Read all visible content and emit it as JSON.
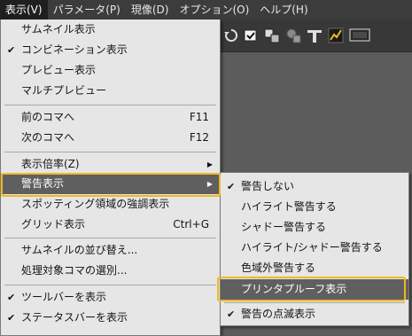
{
  "menubar": {
    "items": [
      {
        "label": "表示(V)"
      },
      {
        "label": "パラメータ(P)"
      },
      {
        "label": "現像(D)"
      },
      {
        "label": "オプション(O)"
      },
      {
        "label": "ヘルプ(H)"
      }
    ]
  },
  "view_menu": {
    "items": [
      {
        "label": "サムネイル表示",
        "checked": false
      },
      {
        "label": "コンビネーション表示",
        "checked": true
      },
      {
        "label": "プレビュー表示",
        "checked": false
      },
      {
        "label": "マルチプレビュー",
        "checked": false
      },
      {
        "label": "前のコマへ",
        "shortcut": "F11"
      },
      {
        "label": "次のコマへ",
        "shortcut": "F12"
      },
      {
        "label": "表示倍率(Z)",
        "submenu": true
      },
      {
        "label": "警告表示",
        "submenu": true,
        "highlighted": true
      },
      {
        "label": "スポッティング領域の強調表示"
      },
      {
        "label": "グリッド表示",
        "shortcut": "Ctrl+G"
      },
      {
        "label": "サムネイルの並び替え..."
      },
      {
        "label": "処理対象コマの選別..."
      },
      {
        "label": "ツールバーを表示",
        "checked": true
      },
      {
        "label": "ステータスバーを表示",
        "checked": true
      }
    ]
  },
  "warning_submenu": {
    "items": [
      {
        "label": "警告しない",
        "checked": true
      },
      {
        "label": "ハイライト警告する"
      },
      {
        "label": "シャドー警告する"
      },
      {
        "label": "ハイライト/シャドー警告する"
      },
      {
        "label": "色域外警告する"
      },
      {
        "label": "プリンタプルーフ表示",
        "highlighted": true
      },
      {
        "label": "警告の点滅表示",
        "checked": true
      }
    ]
  },
  "glyphs": {
    "check": "✔",
    "submenu_arrow": "▶"
  },
  "colors": {
    "callout": "#f0b820",
    "highlight": "#5f5f5f",
    "menu_bg": "#e6e6e6"
  }
}
